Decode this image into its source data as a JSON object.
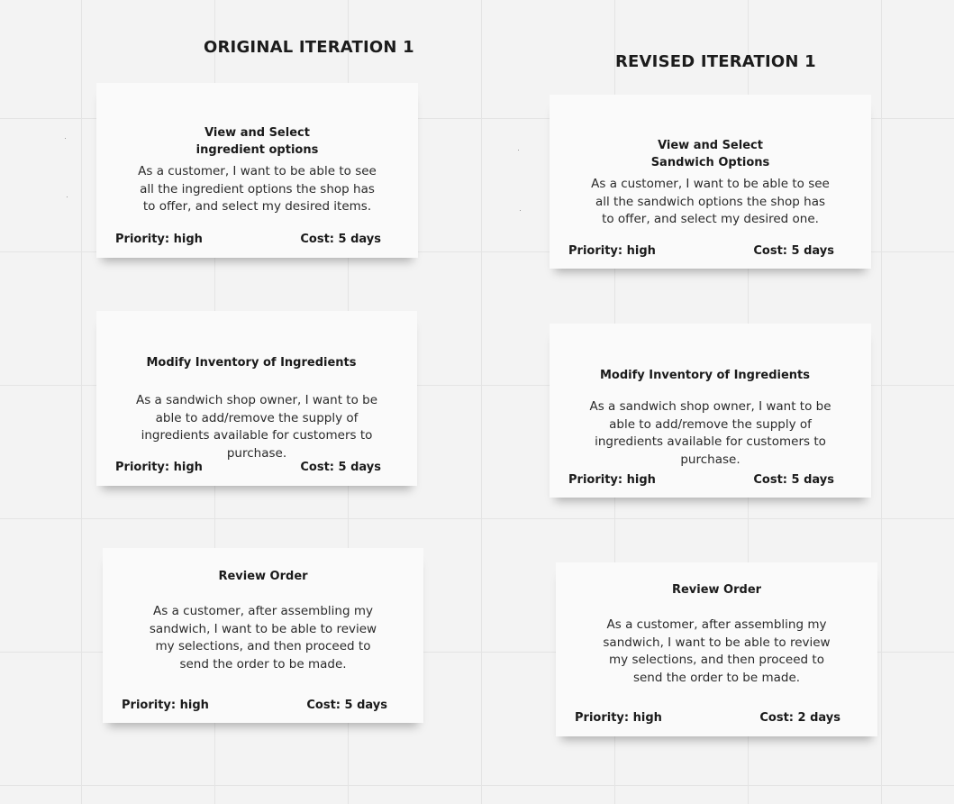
{
  "columns": [
    {
      "title": "ORIGINAL ITERATION 1",
      "cards": [
        {
          "title_lines": [
            "View and Select",
            "ingredient options"
          ],
          "body_lines": [
            "As a customer, I want to be able to see",
            "all the ingredient options the shop has",
            "to offer, and select my desired items."
          ],
          "priority": "Priority: high",
          "cost": "Cost: 5 days"
        },
        {
          "title_lines": [
            "Modify Inventory of Ingredients"
          ],
          "body_lines": [
            "As a sandwich shop owner, I want to be",
            "able to add/remove the supply of",
            "ingredients available for customers to",
            "purchase."
          ],
          "priority": "Priority: high",
          "cost": "Cost: 5 days"
        },
        {
          "title_lines": [
            "Review Order"
          ],
          "body_lines": [
            "As a customer, after assembling my",
            "sandwich, I want to be able to review",
            "my selections, and then proceed to",
            "send the order to be made."
          ],
          "priority": "Priority: high",
          "cost": "Cost: 5 days"
        }
      ]
    },
    {
      "title": "REVISED ITERATION 1",
      "cards": [
        {
          "title_lines": [
            "View and Select",
            "Sandwich Options"
          ],
          "body_lines": [
            "As a customer, I want to be able to see",
            "all the sandwich options the shop has",
            "to offer, and select my desired one."
          ],
          "priority": "Priority: high",
          "cost": "Cost: 5 days"
        },
        {
          "title_lines": [
            "Modify Inventory of Ingredients"
          ],
          "body_lines": [
            "As a sandwich shop owner, I want to be",
            "able to add/remove the supply of",
            "ingredients available for customers to",
            "purchase."
          ],
          "priority": "Priority: high",
          "cost": "Cost: 5 days"
        },
        {
          "title_lines": [
            "Review Order"
          ],
          "body_lines": [
            "As a customer, after assembling my",
            "sandwich, I want to be able to review",
            "my selections, and then proceed to",
            "send the order to be made."
          ],
          "priority": "Priority: high",
          "cost": "Cost: 2 days"
        }
      ]
    }
  ]
}
